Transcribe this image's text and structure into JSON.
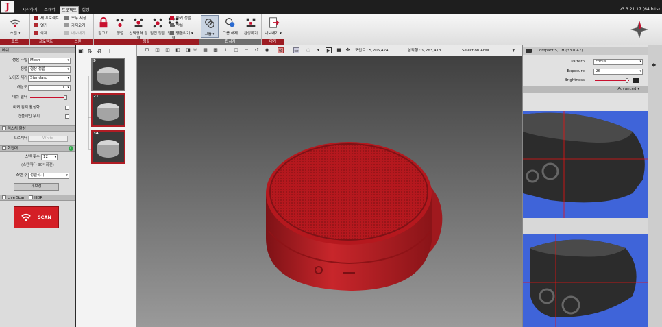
{
  "window": {
    "version": "v3.3.21.17  (64 bits)"
  },
  "menu_tabs": [
    {
      "label": "시작하기"
    },
    {
      "label": "스캐너"
    },
    {
      "label": "프로젝트"
    },
    {
      "label": "설정"
    }
  ],
  "ribbon": {
    "scan_group": {
      "label": "스캔",
      "group_label": "모드"
    },
    "project_group": {
      "group_label": "프로젝트",
      "items": [
        {
          "label": "새 프로젝트"
        },
        {
          "label": "열기"
        },
        {
          "label": "삭제"
        }
      ]
    },
    "scan_data_group": {
      "group_label": "스캔",
      "items": [
        {
          "label": "모두 저장"
        },
        {
          "label": "가져오기"
        },
        {
          "label": "내보내기"
        }
      ]
    },
    "align_group": {
      "group_label": "정렬",
      "buttons": [
        {
          "label": "잠그기",
          "icon": "lock-icon"
        },
        {
          "label": "정렬",
          "icon": "align-icon"
        },
        {
          "label": "선택영역 정렬",
          "icon": "align-selection-icon"
        },
        {
          "label": "점집 정렬",
          "icon": "point-align-icon"
        },
        {
          "label": "정렬 정렬",
          "icon": "dots-align-icon"
        }
      ],
      "side_items": [
        {
          "label": "마커 정렬"
        },
        {
          "label": "반복"
        },
        {
          "label": "되돌리기"
        }
      ]
    },
    "merge_group": {
      "group_label": "합치기",
      "buttons": [
        {
          "label": "그룹"
        },
        {
          "label": "그룹 해제"
        },
        {
          "label": "완성하기"
        }
      ]
    },
    "export_group": {
      "group_label": "마기",
      "button_label": "내보내기"
    }
  },
  "left_panel": {
    "scan_section": {
      "header": "메쉬",
      "rows": [
        {
          "label": "생성 타입",
          "value": "Mesh"
        },
        {
          "label": "정렬",
          "value": "형상 정렬"
        },
        {
          "label": "노이즈 제거",
          "value": "Standard"
        },
        {
          "label": "해상도",
          "value": "1"
        }
      ],
      "slider_label": "메쉬 필터",
      "checks": [
        {
          "label": "마커 감지 활성화"
        },
        {
          "label": "컨플레인 무시"
        }
      ]
    },
    "texture_section": {
      "header": "텍스처 활성",
      "label": "프로젝터",
      "value": "White"
    },
    "turntable_section": {
      "header": "회전대",
      "rows": [
        {
          "label": "스텐 횟수",
          "value": "12"
        },
        {
          "label": "(스텐마다 30° 회전)",
          "value": ""
        },
        {
          "label": "스텐 후",
          "value": "정렬하기"
        }
      ],
      "calibrate_label": "재보정"
    },
    "options": {
      "live_scan": "Live Scan",
      "hdr": "HDR"
    },
    "scan_button": {
      "label": "SCAN"
    }
  },
  "thumbnails": [
    {
      "number": "9"
    },
    {
      "number": "21"
    },
    {
      "number": "34"
    }
  ],
  "viewport": {
    "stats": {
      "points_label": "포인트 :",
      "points": "5,205,424",
      "triangles_label": "삼각형 :",
      "triangles": "9,263,413",
      "mode": "Selection Area"
    },
    "help": "?"
  },
  "right_panel": {
    "camera_title": "Compact S,L,H (331047)",
    "pattern": {
      "label": "Pattern",
      "value": "Focus"
    },
    "exposure": {
      "label": "Exposure",
      "value": "26"
    },
    "brightness": {
      "label": "Brightness"
    },
    "advanced": {
      "label": "Advanced"
    }
  },
  "colors": {
    "accent": "#c8102e",
    "ribbon_label": "#9c1b22",
    "model": "#c0262c",
    "camera_bg": "#3f64d9"
  }
}
